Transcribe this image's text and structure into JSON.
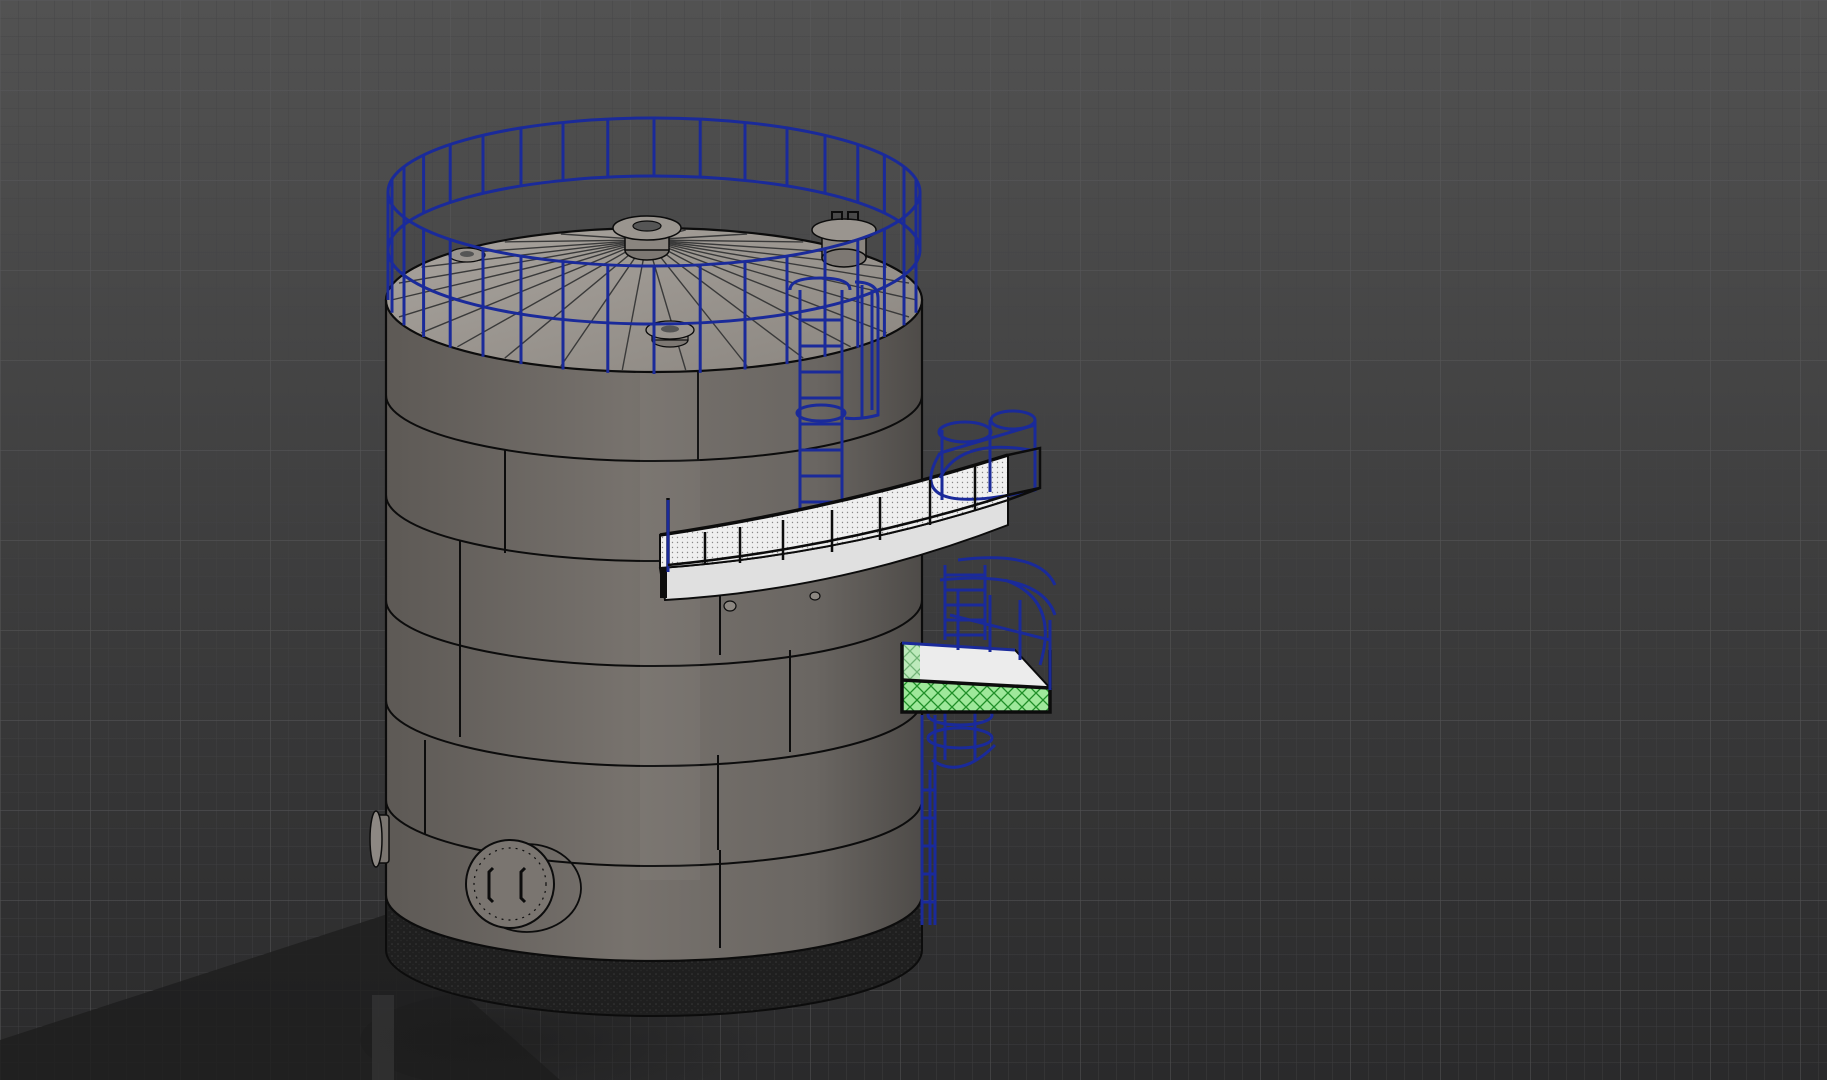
{
  "viewport": {
    "background_top": "#525252",
    "background_bottom": "#2a2a2b",
    "grid_major": "#5b5b5d",
    "grid_minor": "#434345",
    "show_grid": true
  },
  "model": {
    "shell_color": "#6e6a66",
    "shell_light": "#8e8984",
    "roof_color": "#9b9690",
    "edge_color": "#0c0c0c",
    "railing_color": "#1a2a9a",
    "platform_color": "#ececec",
    "selection_color": "#2ecc40",
    "foundation_color": "#1f1f1f",
    "components": [
      "tank-shell",
      "tank-roof",
      "roof-handrail",
      "ladder-upper",
      "platform-upper",
      "platform-lower-selected",
      "ladder-lower",
      "manway",
      "side-nozzle",
      "foundation-ring"
    ]
  }
}
